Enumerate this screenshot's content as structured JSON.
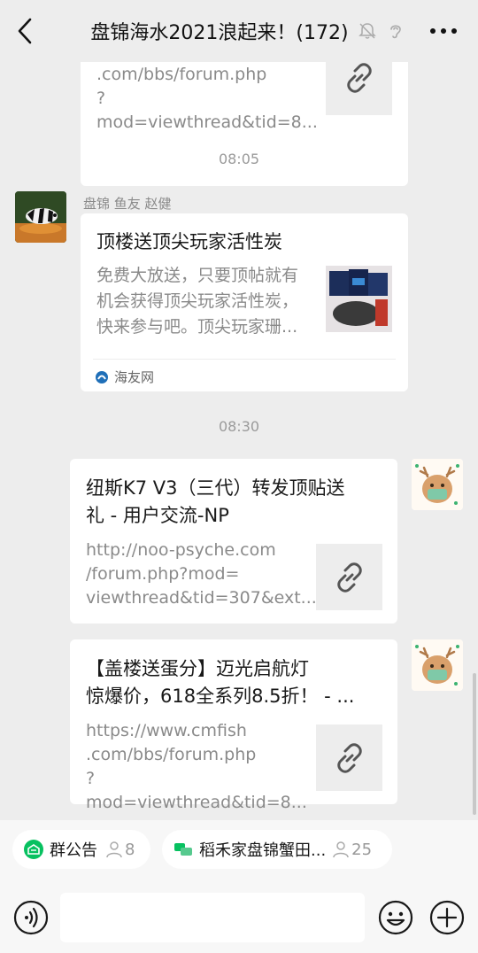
{
  "header": {
    "title": "盘锦海水2021浪起来！(172)"
  },
  "messages": {
    "m1": {
      "url_text_lines": [
        ".com/bbs/forum.php",
        "?mod=viewthread&tid=8..."
      ]
    },
    "time1": "08:05",
    "m2": {
      "sender": "盘锦 鱼友 赵健",
      "title": "顶楼送顶尖玩家活性炭",
      "desc_lines": [
        "免费大放送，只要顶帖就有",
        "机会获得顶尖玩家活性炭，",
        "快来参与吧。顶尖玩家珊..."
      ],
      "source": "海友网"
    },
    "time2": "08:30",
    "m3": {
      "title_lines": [
        "纽斯K7 V3（三代）转发顶贴送",
        "礼 - 用户交流-NP"
      ],
      "url_lines": [
        "http://noo-psyche.com",
        "/forum.php?mod=",
        "viewthread&tid=307&ext..."
      ]
    },
    "m4": {
      "title_lines": [
        "【盖楼送蛋分】迈光启航灯",
        "惊爆价，618全系列8.5折！ - ..."
      ],
      "url_lines": [
        "https://www.cmfish",
        ".com/bbs/forum.php",
        "?mod=viewthread&tid=8..."
      ]
    }
  },
  "bottom": {
    "pill1": {
      "label": "群公告",
      "count": "8"
    },
    "pill2": {
      "label": "稻禾家盘锦蟹田...",
      "count": "25"
    }
  },
  "colors": {
    "background": "#ededed",
    "bubble": "#ffffff",
    "accent_green": "#07c160"
  }
}
